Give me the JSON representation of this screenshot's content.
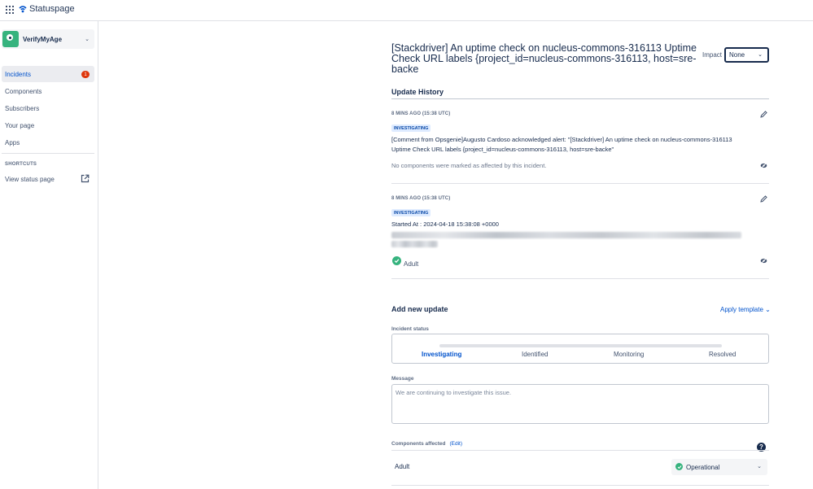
{
  "topbar": {
    "brand": "Statuspage"
  },
  "sidebar": {
    "page_name": "VerifyMyAge",
    "items": [
      {
        "label": "Incidents",
        "badge": "1"
      },
      {
        "label": "Components"
      },
      {
        "label": "Subscribers"
      },
      {
        "label": "Your page"
      },
      {
        "label": "Apps"
      }
    ],
    "shortcuts_label": "SHORTCUTS",
    "shortcut": "View status page"
  },
  "incident": {
    "title": "[Stackdriver] An uptime check on nucleus-commons-316113 Uptime Check URL labels {project_id=nucleus-commons-316113, host=sre-backe",
    "impact_label": "Impact",
    "impact_value": "None"
  },
  "history": {
    "title": "Update History",
    "updates": [
      {
        "time": "8 MINS AGO (15:38 UTC)",
        "status": "INVESTIGATING",
        "text": "[Comment from Opsgenie]Augusto Cardoso acknowledged alert: \"[Stackdriver] An uptime check on nucleus-commons-316113 Uptime Check URL labels {project_id=nucleus-commons-316113, host=sre-backe\"",
        "note": "No components were marked as affected by this incident."
      },
      {
        "time": "8 MINS AGO (15:38 UTC)",
        "status": "INVESTIGATING",
        "text": "Started At : 2024-04-18 15:38:08 +0000",
        "component": "Adult"
      }
    ]
  },
  "new_update": {
    "title": "Add new update",
    "apply_template": "Apply template",
    "status_label": "Incident status",
    "steps": [
      "Investigating",
      "Identified",
      "Monitoring",
      "Resolved"
    ],
    "message_label": "Message",
    "message_placeholder": "We are continuing to investigate this issue.",
    "components_label": "Components affected",
    "components_edit": "(Edit)",
    "help": "?",
    "component_name": "Adult",
    "component_status": "Operational"
  },
  "colors": {
    "accent": "#0052cc",
    "operational": "#36b37e",
    "badge": "#de350b"
  }
}
